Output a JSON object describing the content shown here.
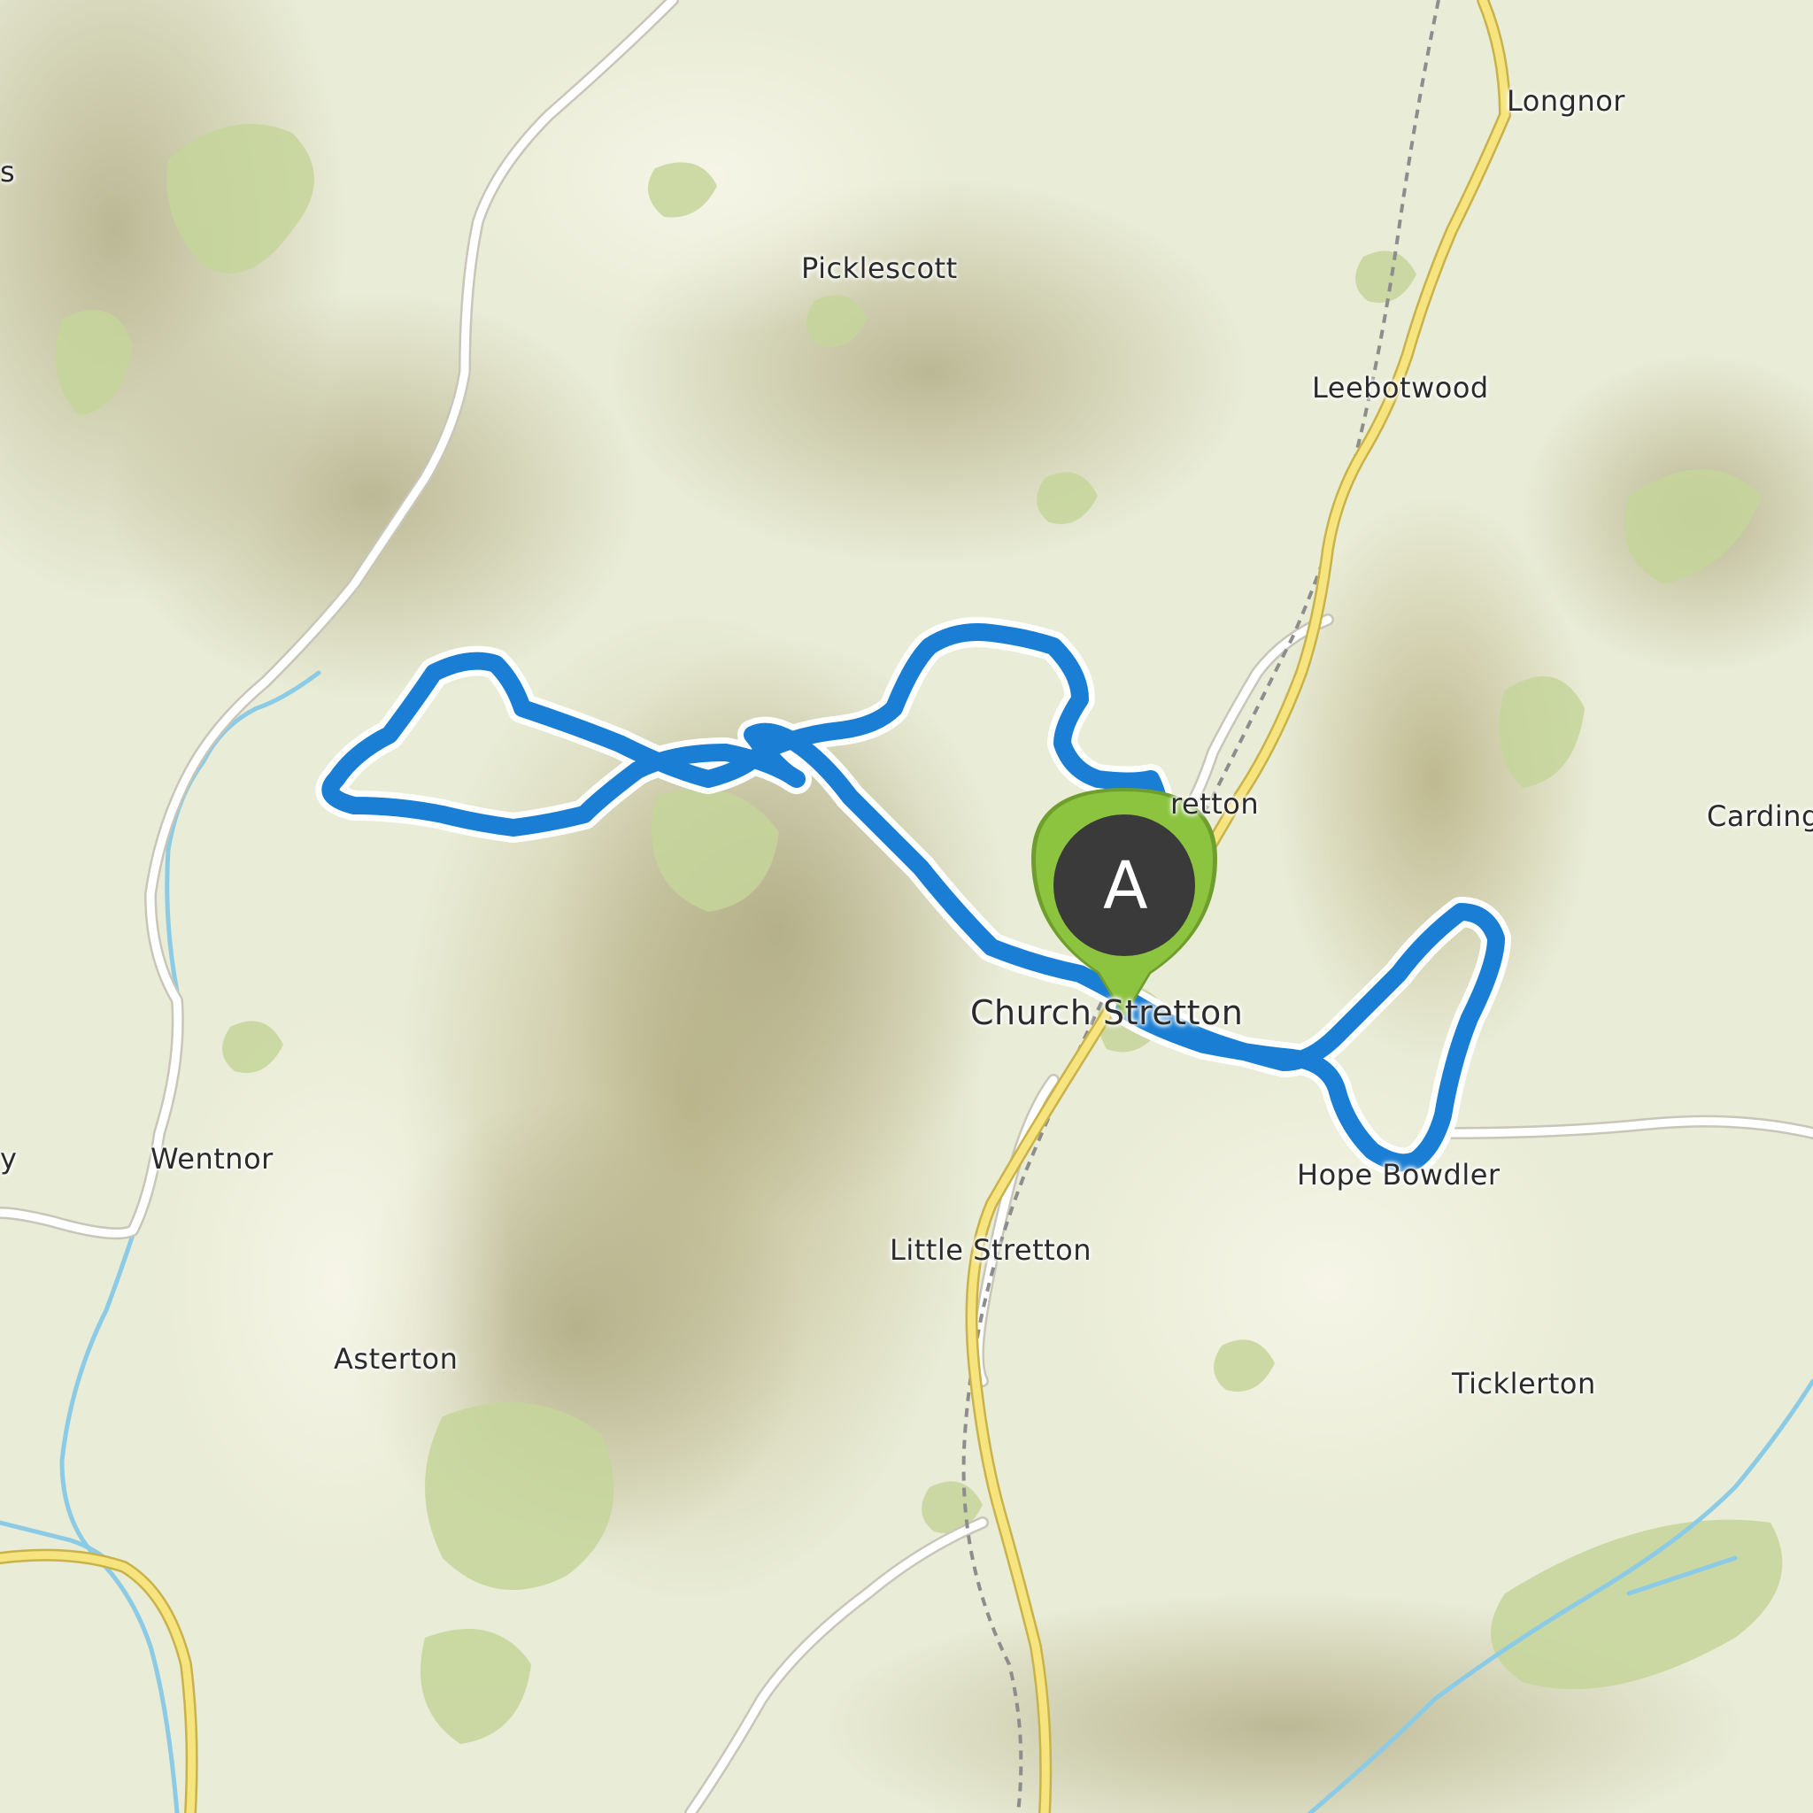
{
  "map": {
    "places": {
      "longnor": "Longnor",
      "picklescott": "Picklescott",
      "leebotwood": "Leebotwood",
      "all_stretton": "retton",
      "carding_mill": "Carding",
      "church_stretton": "Church Stretton",
      "wentnor": "Wentnor",
      "hope_bowdler": "Hope Bowdler",
      "little_stretton": "Little Stretton",
      "asterton": "Asterton",
      "ticklerton": "Ticklerton",
      "edge_left_top": "s",
      "edge_left_mid": "y"
    },
    "start_marker": {
      "letter": "A",
      "color": "#8cc43f"
    },
    "route": {
      "color": "#1a7fd4",
      "outline": "#ffffff"
    },
    "colors": {
      "land": "#e9ecd6",
      "woodland": "#c9d8a1",
      "hill_shade": "#bcb68f",
      "major_road": "#f5e27a",
      "minor_road": "#ffffff",
      "water": "#7cc3e3",
      "railway": "#9a9a9a"
    }
  }
}
